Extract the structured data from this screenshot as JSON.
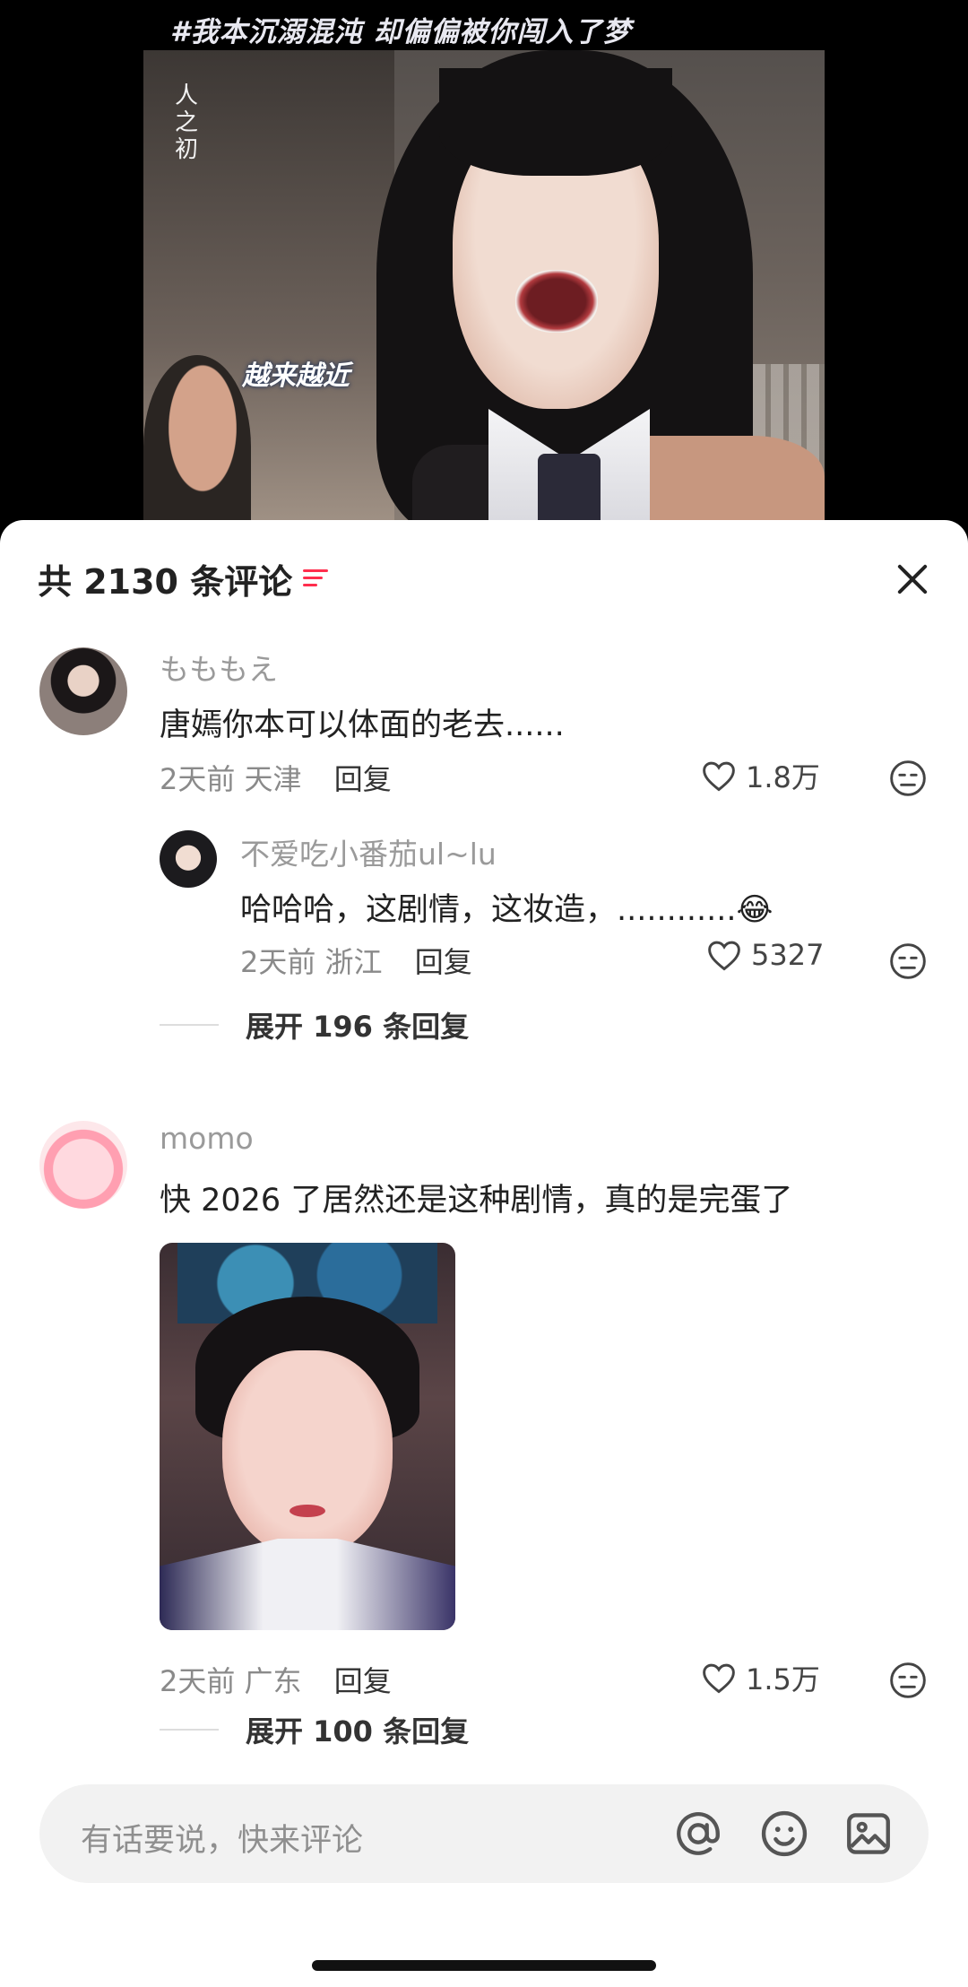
{
  "video": {
    "caption": "#我本沉溺混沌 却偏偏被你闯入了梦",
    "logo": "人之初",
    "subtitle": "越来越近"
  },
  "sheet": {
    "title": "共 2130 条评论",
    "filter_icon": "filter-icon",
    "close_icon": "close-icon"
  },
  "comments": [
    {
      "username": "もももえ",
      "text": "唐嫣你本可以体面的老去......",
      "time": "2天前",
      "location": "天津",
      "reply_label": "回复",
      "likes": "1.8万",
      "replies": [
        {
          "username": "不爱吃小番茄ul~lu",
          "text": "哈哈哈，这剧情，这妆造，............",
          "emoji": "😂",
          "time": "2天前",
          "location": "浙江",
          "reply_label": "回复",
          "likes": "5327"
        }
      ],
      "expand_label": "展开 196 条回复"
    },
    {
      "username": "momo",
      "text": "快 2026 了居然还是这种剧情，真的是完蛋了",
      "time": "2天前",
      "location": "广东",
      "reply_label": "回复",
      "likes": "1.5万",
      "expand_label": "展开 100 条回复"
    }
  ],
  "input": {
    "placeholder": "有话要说，快来评论",
    "icons": [
      "at-icon",
      "emoji-icon",
      "image-icon"
    ]
  },
  "colors": {
    "accent": "#ff2e4d",
    "sheet_bg": "#ffffff",
    "input_bg": "#f2f2f2"
  }
}
